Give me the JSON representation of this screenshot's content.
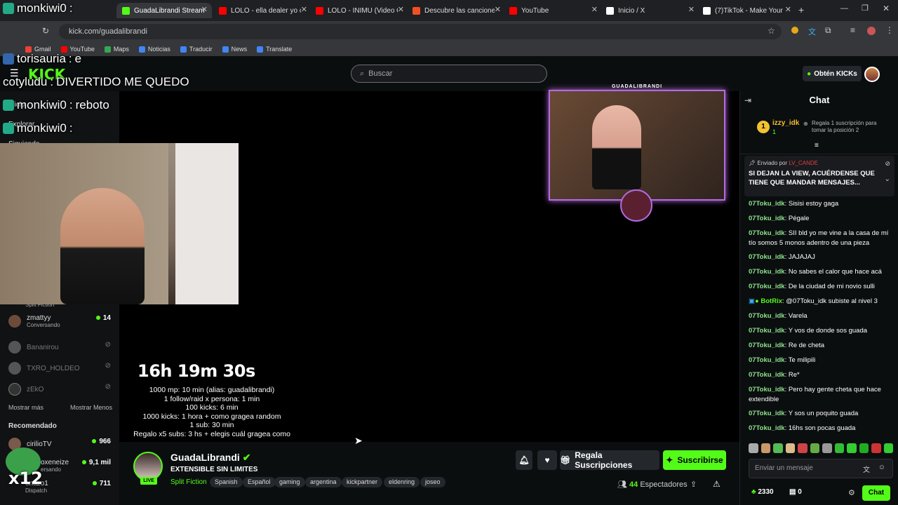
{
  "browser": {
    "tabs": [
      {
        "title": "GuadaLibrandi Stream - V",
        "favicon_color": "#53fc18",
        "active": true
      },
      {
        "title": "LOLO - ella dealer yo chi",
        "favicon_color": "#ff0000"
      },
      {
        "title": "LOLO - INIMU (Video Ofi",
        "favicon_color": "#ff0000"
      },
      {
        "title": "Descubre las canciones m",
        "favicon_color": "#f25022"
      },
      {
        "title": "YouTube",
        "favicon_color": "#ff0000"
      },
      {
        "title": "Inicio / X",
        "favicon_color": "#ffffff"
      },
      {
        "title": "(7)TikTok - Make Your Da",
        "favicon_color": "#ffffff"
      }
    ],
    "url": "kick.com/guadalibrandi",
    "bookmarks": [
      "Gmail",
      "YouTube",
      "Maps",
      "Noticias",
      "Traducir",
      "News",
      "Translate"
    ]
  },
  "site": {
    "search_placeholder": "Buscar",
    "get_kicks_label": "Obtén KICKs",
    "brand_color": "#53fc18"
  },
  "sidebar": {
    "nav": [
      "Inicio",
      "Explorar",
      "Siguiendo"
    ],
    "following": [
      {
        "name": "",
        "sub": "Split Fiction",
        "count": ""
      },
      {
        "name": "zmattyy",
        "sub": "Conversando",
        "count": "14"
      },
      {
        "name": "Bananirou",
        "sub": "",
        "count": ""
      },
      {
        "name": "TXRO_HOLDEO",
        "sub": "",
        "count": ""
      },
      {
        "name": "zEkO",
        "sub": "",
        "count": ""
      }
    ],
    "show_more": "Mostrar más",
    "show_less": "Mostrar Menos",
    "recommended_title": "Recomendado",
    "recommended": [
      {
        "name": "cirilioTV",
        "sub": "",
        "count": "966"
      },
      {
        "name": "oxeneize",
        "sub": "ersando",
        "count": "9,1 mil"
      },
      {
        "name": "onazo1",
        "sub": "Dispatch",
        "count": "711"
      }
    ]
  },
  "overlay_chat": [
    {
      "user": "monkiwi0",
      "text": ""
    },
    {
      "user": "torisauria",
      "text": "e"
    },
    {
      "user": "cotyludu",
      "text": "DIVERTIDO ME QUEDO"
    },
    {
      "user": "monkiwi0",
      "text": "reboto"
    },
    {
      "user": "monkiwi0",
      "text": ""
    }
  ],
  "overlay_multiplier": "x12",
  "stream": {
    "cam_label": "GUADALIBRANDI",
    "timer": "16h 19m 30s",
    "rules": [
      "1000 mp: 10 min (alias: guadalibrandi)",
      "1 follow/raid x persona: 1 min",
      "100 kicks: 6 min",
      "1000 kicks: 1 hora + como gragea random",
      "1 sub: 30 min",
      "Regalo x5 subs: 3 hs + elegis cuál gragea como"
    ]
  },
  "channel": {
    "name": "GuadaLibrandi",
    "live_label": "LIVE",
    "title": "EXTENSIBLE SIN LIMITES",
    "category": "Split Fiction",
    "tags": [
      "Spanish",
      "Español",
      "gaming",
      "argentina",
      "kickpartner",
      "eldenring",
      "joseo"
    ],
    "gift_label": "Regala Suscripciones",
    "subscribe_label": "Suscribirse",
    "viewers_count": "44",
    "viewers_label": "Espectadores"
  },
  "chat": {
    "title": "Chat",
    "top_gifter": {
      "name": "izzy_idk",
      "rank": "1",
      "count": "1"
    },
    "gift_prompt": "Regala 1 suscripción para tomar la posición 2",
    "pinned_by_label": "Enviado por",
    "pinned_by_user": "LV_CANDE",
    "pinned_text": "SI DEJAN LA VIEW, ACUÉRDENSE QUE TIENE QUE MANDAR MENSAJES...",
    "messages": [
      {
        "user": "07Toku_idk",
        "text": "Sisisi estoy gaga"
      },
      {
        "user": "07Toku_idk",
        "text": "Pégale"
      },
      {
        "user": "07Toku_idk",
        "text": "SII bld yo me vine a la casa de mí tío somos 5 monos adentro de una pieza"
      },
      {
        "user": "07Toku_idk",
        "text": "JAJAJAJ"
      },
      {
        "user": "07Toku_idk",
        "text": "No sabes el calor que hace acá"
      },
      {
        "user": "07Toku_idk",
        "text": "De la ciudad de mi novio sulli"
      },
      {
        "user": "BotRix",
        "text": "@07Toku_idk subiste al nivel 3"
      },
      {
        "user": "07Toku_idk",
        "text": "Varela"
      },
      {
        "user": "07Toku_idk",
        "text": "Y vos de donde sos guada"
      },
      {
        "user": "07Toku_idk",
        "text": "Re de cheta"
      },
      {
        "user": "07Toku_idk",
        "text": "Te milipili"
      },
      {
        "user": "07Toku_idk",
        "text": "Re*"
      },
      {
        "user": "07Toku_idk",
        "text": "Pero hay gente cheta que hace extendible"
      },
      {
        "user": "07Toku_idk",
        "text": "Y sos un poquito guada"
      },
      {
        "user": "07Toku_idk",
        "text": "16hs son pocas guada"
      }
    ],
    "input_placeholder": "Enviar un mensaje",
    "kicks_balance": "2330",
    "points_balance": "0",
    "send_label": "Chat"
  }
}
